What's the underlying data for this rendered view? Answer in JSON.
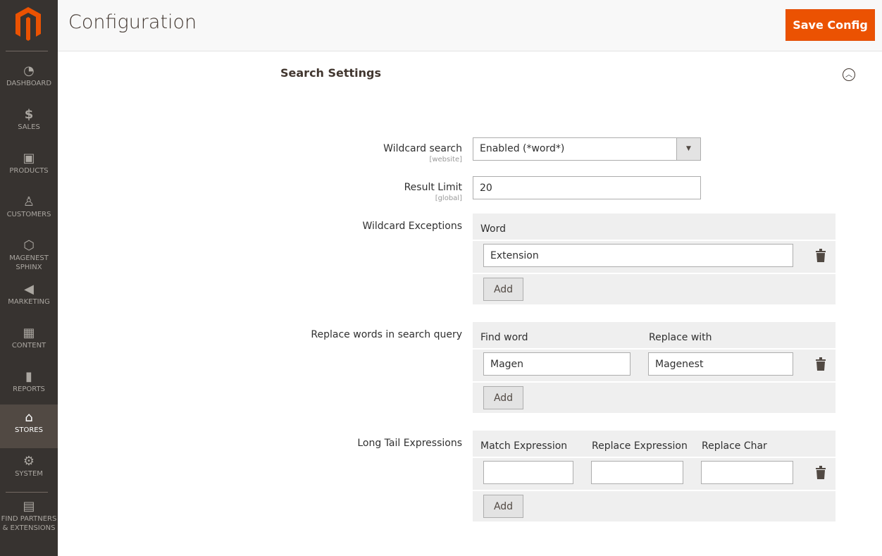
{
  "sidebar": {
    "items": [
      {
        "label": "DASHBOARD",
        "icon": "dashboard-icon"
      },
      {
        "label": "SALES",
        "icon": "dollar-icon"
      },
      {
        "label": "PRODUCTS",
        "icon": "box-icon"
      },
      {
        "label": "CUSTOMERS",
        "icon": "person-icon"
      },
      {
        "label": "MAGENEST SPHINX",
        "icon": "hexagon-icon"
      },
      {
        "label": "MARKETING",
        "icon": "megaphone-icon"
      },
      {
        "label": "CONTENT",
        "icon": "layout-icon"
      },
      {
        "label": "REPORTS",
        "icon": "bar-chart-icon"
      },
      {
        "label": "STORES",
        "icon": "store-icon",
        "active": true
      },
      {
        "label": "SYSTEM",
        "icon": "gear-icon"
      },
      {
        "label": "FIND PARTNERS & EXTENSIONS",
        "icon": "blocks-icon"
      }
    ]
  },
  "header": {
    "title": "Configuration",
    "save_label": "Save Config"
  },
  "section": {
    "title": "Search Settings"
  },
  "fields": {
    "wildcard": {
      "label": "Wildcard search",
      "scope": "[website]",
      "value": "Enabled (*word*)"
    },
    "limit": {
      "label": "Result Limit",
      "scope": "[global]",
      "value": "20"
    },
    "exceptions": {
      "label": "Wildcard Exceptions",
      "columns": [
        "Word"
      ],
      "rows": [
        [
          "Extension"
        ]
      ],
      "add": "Add"
    },
    "replace": {
      "label": "Replace words in search query",
      "columns": [
        "Find word",
        "Replace with"
      ],
      "rows": [
        [
          "Magen",
          "Magenest"
        ]
      ],
      "add": "Add"
    },
    "longtail": {
      "label": "Long Tail Expressions",
      "columns": [
        "Match Expression",
        "Replace Expression",
        "Replace Char"
      ],
      "rows": [
        [
          "",
          "",
          ""
        ]
      ],
      "add": "Add"
    }
  },
  "colors": {
    "accent": "#eb5202",
    "sidebar": "#373330"
  }
}
